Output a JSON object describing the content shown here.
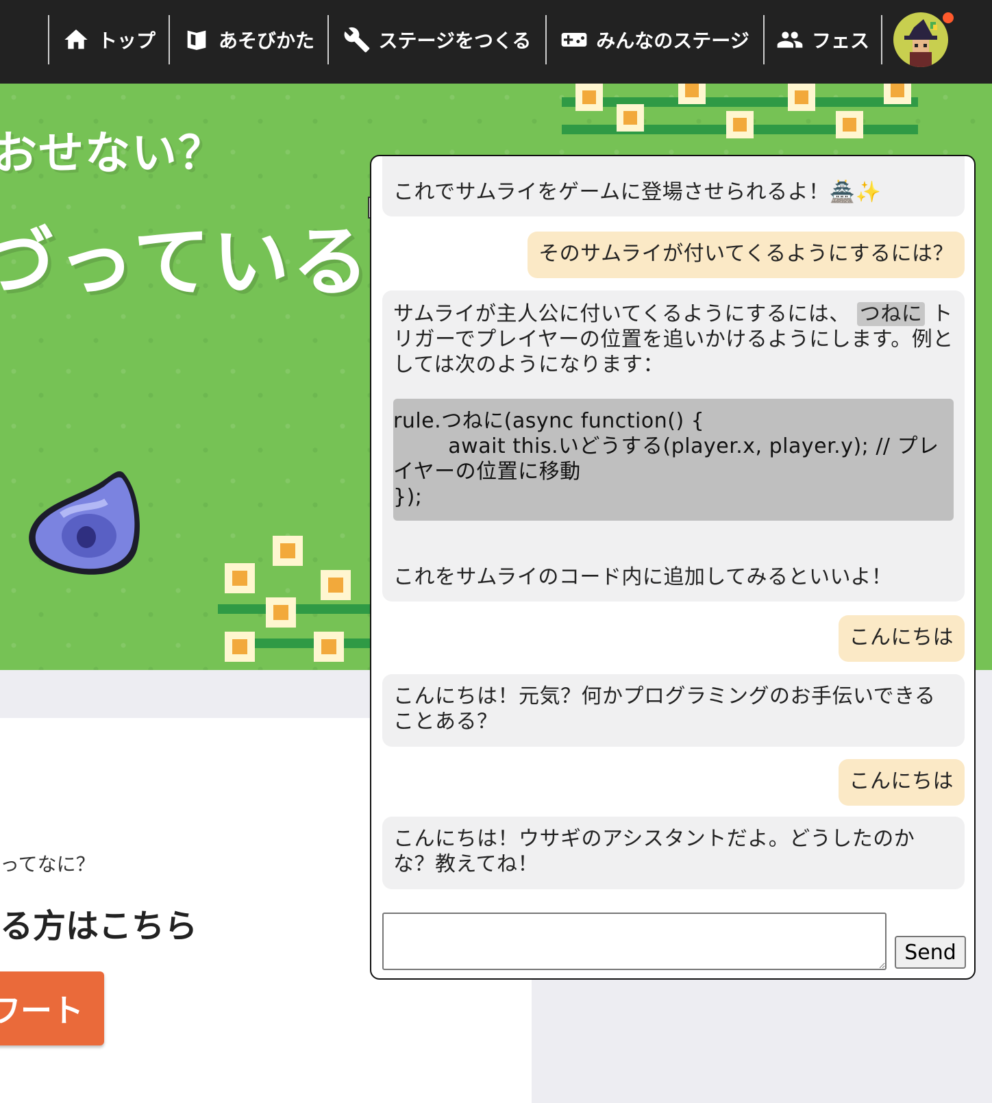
{
  "nav": {
    "items": [
      {
        "label": "トップ",
        "icon": "home-icon"
      },
      {
        "label": "あそびかた",
        "icon": "book-icon"
      },
      {
        "label": "ステージをつくる",
        "icon": "wrench-icon"
      },
      {
        "label": "みんなのステージ",
        "icon": "gamepad-icon"
      },
      {
        "label": "フェス",
        "icon": "people-icon"
      }
    ],
    "avatar": "user-avatar"
  },
  "hero": {
    "line1": "おせない？",
    "line2": "づっているね！"
  },
  "page": {
    "question": "ってなに？",
    "here_title": "る方はこちら",
    "start_button": "ワート"
  },
  "chat": {
    "messages": [
      {
        "role": "bot",
        "text": "これでサムライをゲームに登場させられるよ！🏯✨"
      },
      {
        "role": "user",
        "text": "そのサムライが付いてくるようにするには？"
      },
      {
        "role": "bot",
        "text_before": "サムライが主人公に付いてくるようにするには、",
        "inline_code": "つねに",
        "text_after": "トリガーでプレイヤーの位置を追いかけるようにします。例としては次のようになります：",
        "code": "rule.つねに(async function() {\n        await this.いどうする(player.x, player.y); // プレイヤーの位置に移動\n});",
        "text_end": "これをサムライのコード内に追加してみるといいよ！"
      },
      {
        "role": "user",
        "text": "こんにちは"
      },
      {
        "role": "bot",
        "text": "こんにちは！元気？何かプログラミングのお手伝いできることある？"
      },
      {
        "role": "user",
        "text": "こんにちは"
      },
      {
        "role": "bot",
        "text": "こんにちは！ウサギのアシスタントだよ。どうしたのかな？教えてね！"
      }
    ],
    "input_value": "",
    "send_label": "Send"
  },
  "colors": {
    "nav_bg": "#222222",
    "hero_green": "#76c255",
    "user_bubble": "#fbe9c6",
    "bot_bubble": "#f0f0f1",
    "code_bg": "#bfbfbf",
    "start_button": "#ea6a3a",
    "notification_dot": "#ff5a2c"
  }
}
